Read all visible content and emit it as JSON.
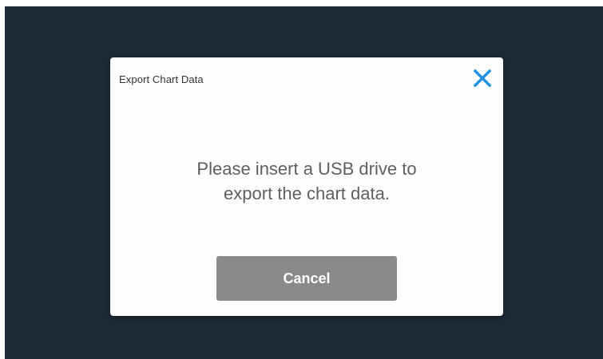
{
  "dialog": {
    "title": "Export Chart Data",
    "close_icon": "close-icon",
    "message_lines": [
      "Please insert a USB drive to",
      "export the chart data."
    ],
    "cancel_label": "Cancel"
  },
  "colors": {
    "backdrop": "#1d2a37",
    "dialog_background": "#fefefe",
    "close_icon": "#1e90e6",
    "cancel_button": "#8a8a8a",
    "message_text": "#5f5f5f"
  }
}
